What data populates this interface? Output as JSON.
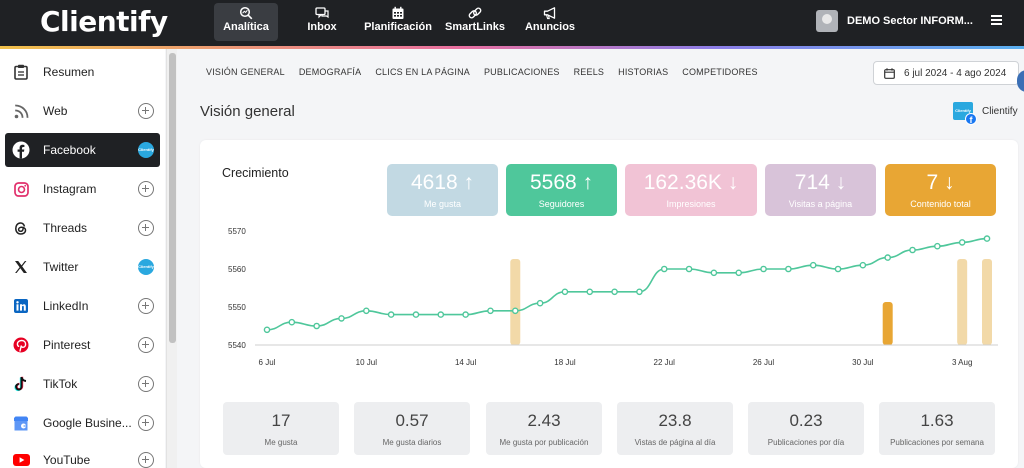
{
  "app": {
    "logo": "Clientify"
  },
  "topnav": [
    {
      "label": "Analítica",
      "icon": "analytics-icon",
      "active": true
    },
    {
      "label": "Inbox",
      "icon": "chat-icon"
    },
    {
      "label": "Planificación",
      "icon": "calendar-icon"
    },
    {
      "label": "SmartLinks",
      "icon": "link-icon"
    },
    {
      "label": "Anuncios",
      "icon": "megaphone-icon"
    }
  ],
  "user": {
    "name": "DEMO Sector INFORM..."
  },
  "sidebar": {
    "items": [
      {
        "label": "Resumen",
        "icon": "clipboard-icon",
        "action": "none"
      },
      {
        "label": "Web",
        "icon": "rss-icon",
        "action": "add"
      },
      {
        "label": "Facebook",
        "icon": "facebook-icon",
        "action": "connected",
        "active": true
      },
      {
        "label": "Instagram",
        "icon": "instagram-icon",
        "action": "add"
      },
      {
        "label": "Threads",
        "icon": "threads-icon",
        "action": "add"
      },
      {
        "label": "Twitter",
        "icon": "x-icon",
        "action": "connected"
      },
      {
        "label": "LinkedIn",
        "icon": "linkedin-icon",
        "action": "add"
      },
      {
        "label": "Pinterest",
        "icon": "pinterest-icon",
        "action": "add"
      },
      {
        "label": "TikTok",
        "icon": "tiktok-icon",
        "action": "add"
      },
      {
        "label": "Google Busine...",
        "icon": "google-business-icon",
        "action": "add"
      },
      {
        "label": "YouTube",
        "icon": "youtube-icon",
        "action": "add"
      }
    ],
    "connected_badge": "Clientify"
  },
  "tabs": [
    "VISIÓN GENERAL",
    "DEMOGRAFÍA",
    "CLICS EN LA PÁGINA",
    "PUBLICACIONES",
    "REELS",
    "HISTORIAS",
    "COMPETIDORES"
  ],
  "date_range": "6 jul 2024 - 4 ago 2024",
  "page_title": "Visión general",
  "brand": {
    "name": "Clientify",
    "badge": "Clientify",
    "network_glyph": "f"
  },
  "growth": {
    "title": "Crecimiento",
    "kpis": [
      {
        "value": "4618",
        "trend": "up",
        "label": "Me gusta",
        "color": "#c2d9e3"
      },
      {
        "value": "5568",
        "trend": "up",
        "label": "Seguidores",
        "color": "#4fc79b"
      },
      {
        "value": "162.36K",
        "trend": "down",
        "label": "Impresiones",
        "color": "#f1c3d5"
      },
      {
        "value": "714",
        "trend": "down",
        "label": "Visitas a página",
        "color": "#d8c3d9"
      },
      {
        "value": "7",
        "trend": "down",
        "label": "Contenido total",
        "color": "#e8a634"
      }
    ]
  },
  "chart_data": {
    "type": "line",
    "x": [
      "2024-07-06",
      "2024-07-07",
      "2024-07-08",
      "2024-07-09",
      "2024-07-10",
      "2024-07-11",
      "2024-07-12",
      "2024-07-13",
      "2024-07-14",
      "2024-07-15",
      "2024-07-16",
      "2024-07-17",
      "2024-07-18",
      "2024-07-19",
      "2024-07-20",
      "2024-07-21",
      "2024-07-22",
      "2024-07-23",
      "2024-07-24",
      "2024-07-25",
      "2024-07-26",
      "2024-07-27",
      "2024-07-28",
      "2024-07-29",
      "2024-07-30",
      "2024-07-31",
      "2024-08-01",
      "2024-08-02",
      "2024-08-03",
      "2024-08-04"
    ],
    "tick_labels": [
      "6 Jul",
      "10 Jul",
      "14 Jul",
      "18 Jul",
      "22 Jul",
      "26 Jul",
      "30 Jul",
      "3 Aug"
    ],
    "tick_dates": [
      "2024-07-06",
      "2024-07-10",
      "2024-07-14",
      "2024-07-18",
      "2024-07-22",
      "2024-07-26",
      "2024-07-30",
      "2024-08-03"
    ],
    "series": [
      {
        "name": "Seguidores",
        "color": "#4fc79b",
        "values": [
          5544,
          5546,
          5545,
          5547,
          5549,
          5548,
          5548,
          5548,
          5548,
          5549,
          5549,
          5551,
          5554,
          5554,
          5554,
          5554,
          5560,
          5560,
          5559,
          5559,
          5560,
          5560,
          5561,
          5560,
          5561,
          5563,
          5565,
          5566,
          5567,
          5568
        ]
      }
    ],
    "content_bars": [
      {
        "date": "2024-07-16",
        "color": "#f2d9a8",
        "level": 1.0
      },
      {
        "date": "2024-07-31",
        "color": "#e8a634",
        "level": 0.5
      },
      {
        "date": "2024-08-03",
        "color": "#f2d9a8",
        "level": 1.0
      },
      {
        "date": "2024-08-04",
        "color": "#f2d9a8",
        "level": 1.0
      }
    ],
    "ylim": [
      5540,
      5570
    ],
    "yticks": [
      5540,
      5550,
      5560,
      5570
    ],
    "grid": false,
    "xlabel": "",
    "ylabel": ""
  },
  "stats": [
    {
      "value": "17",
      "label": "Me gusta"
    },
    {
      "value": "0.57",
      "label": "Me gusta diarios"
    },
    {
      "value": "2.43",
      "label": "Me gusta por publicación"
    },
    {
      "value": "23.8",
      "label": "Vistas de página al día"
    },
    {
      "value": "0.23",
      "label": "Publicaciones por día"
    },
    {
      "value": "1.63",
      "label": "Publicaciones por semana"
    }
  ]
}
